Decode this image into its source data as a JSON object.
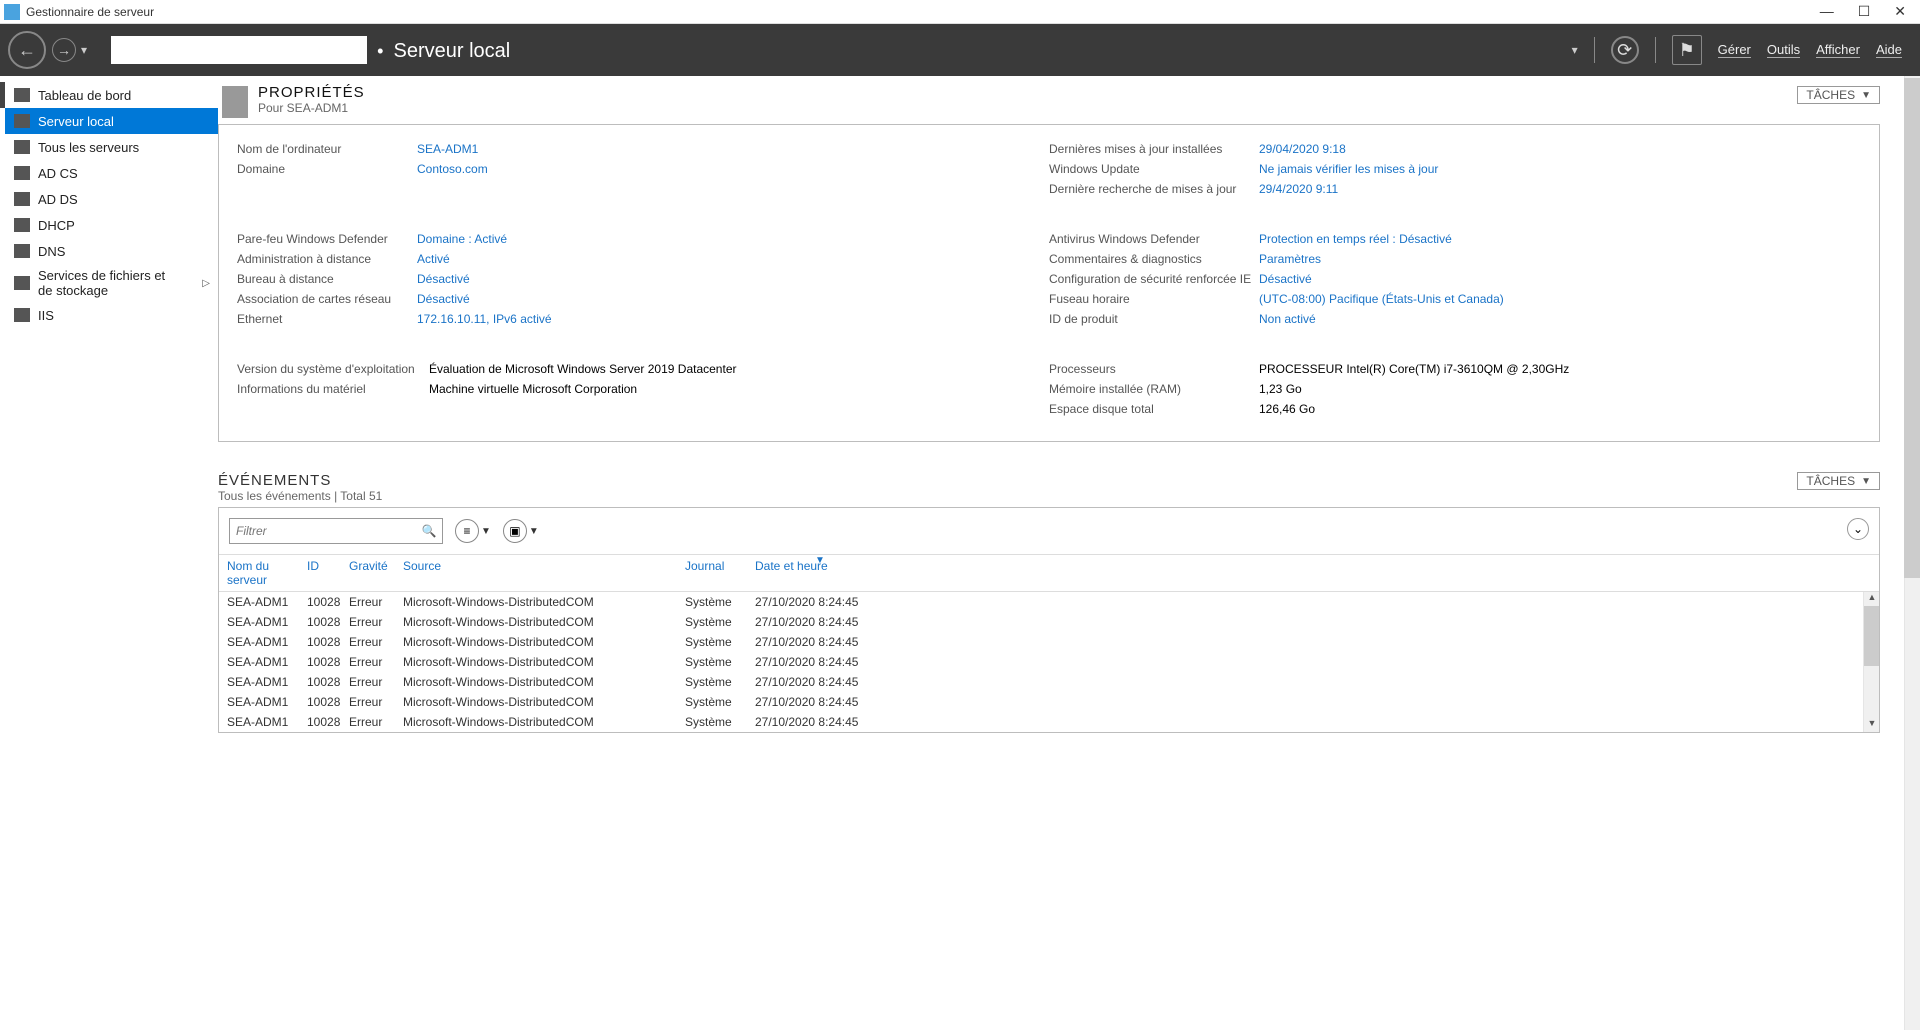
{
  "window": {
    "title": "Gestionnaire de serveur"
  },
  "breadcrumb": {
    "main": "Gestionnaire de serveur",
    "sub": "Serveur local"
  },
  "menu": {
    "gerer": "Gérer",
    "outils": "Outils",
    "afficher": "Afficher",
    "aide": "Aide"
  },
  "sidebar": {
    "items": [
      {
        "label": "Tableau de bord"
      },
      {
        "label": "Serveur local"
      },
      {
        "label": "Tous les serveurs"
      },
      {
        "label": "AD CS"
      },
      {
        "label": "AD DS"
      },
      {
        "label": "DHCP"
      },
      {
        "label": "DNS"
      },
      {
        "label": "Services de fichiers et de stockage"
      },
      {
        "label": "IIS"
      }
    ]
  },
  "properties": {
    "title": "PROPRIÉTÉS",
    "subtitle": "Pour SEA-ADM1",
    "tasks": "TÂCHES",
    "left1": [
      {
        "k": "Nom de l'ordinateur",
        "v": "SEA-ADM1",
        "link": true
      },
      {
        "k": "Domaine",
        "v": "Contoso.com",
        "link": true
      }
    ],
    "right1": [
      {
        "k": "Dernières mises à jour installées",
        "v": "29/04/2020 9:18",
        "link": true
      },
      {
        "k": "Windows Update",
        "v": "Ne jamais vérifier les mises à jour",
        "link": true
      },
      {
        "k": "Dernière recherche de mises à jour",
        "v": "29/4/2020 9:11",
        "link": true
      }
    ],
    "left2": [
      {
        "k": "Pare-feu Windows Defender",
        "v": "Domaine : Activé",
        "link": true
      },
      {
        "k": "Administration à distance",
        "v": "Activé",
        "link": true
      },
      {
        "k": "Bureau à distance",
        "v": "Désactivé",
        "link": true
      },
      {
        "k": "Association de cartes réseau",
        "v": "Désactivé",
        "link": true
      },
      {
        "k": "Ethernet",
        "v": "172.16.10.11, IPv6 activé",
        "link": true
      }
    ],
    "right2": [
      {
        "k": "Antivirus Windows Defender",
        "v": "Protection en temps réel : Désactivé",
        "link": true
      },
      {
        "k": "Commentaires & diagnostics",
        "v": "Paramètres",
        "link": true
      },
      {
        "k": "Configuration de sécurité renforcée IE",
        "v": "Désactivé",
        "link": true
      },
      {
        "k": "Fuseau horaire",
        "v": "(UTC-08:00) Pacifique (États-Unis et Canada)",
        "link": true
      },
      {
        "k": "ID de produit",
        "v": "Non activé",
        "link": true
      }
    ],
    "left3": [
      {
        "k": "Version du système d'exploitation",
        "v": "Évaluation de Microsoft Windows Server 2019 Datacenter",
        "link": false
      },
      {
        "k": "Informations du matériel",
        "v": "Machine virtuelle Microsoft Corporation",
        "link": false
      }
    ],
    "right3": [
      {
        "k": "Processeurs",
        "v": "PROCESSEUR Intel(R) Core(TM) i7-3610QM @ 2,30GHz",
        "link": false
      },
      {
        "k": "Mémoire installée (RAM)",
        "v": "1,23 Go",
        "link": false
      },
      {
        "k": "Espace disque total",
        "v": "126,46 Go",
        "link": false
      }
    ]
  },
  "events": {
    "title": "ÉVÉNEMENTS",
    "subtitle": "Tous les événements | Total 51",
    "tasks": "TÂCHES",
    "filter_placeholder": "Filtrer",
    "columns": {
      "c1": "Nom du serveur",
      "c2": "ID",
      "c3": "Gravité",
      "c4": "Source",
      "c5": "Journal",
      "c6": "Date et heure"
    },
    "rows": [
      {
        "c1": "SEA-ADM1",
        "c2": "10028",
        "c3": "Erreur",
        "c4": "Microsoft-Windows-DistributedCOM",
        "c5": "Système",
        "c6": "27/10/2020 8:24:45"
      },
      {
        "c1": "SEA-ADM1",
        "c2": "10028",
        "c3": "Erreur",
        "c4": "Microsoft-Windows-DistributedCOM",
        "c5": "Système",
        "c6": "27/10/2020 8:24:45"
      },
      {
        "c1": "SEA-ADM1",
        "c2": "10028",
        "c3": "Erreur",
        "c4": "Microsoft-Windows-DistributedCOM",
        "c5": "Système",
        "c6": "27/10/2020 8:24:45"
      },
      {
        "c1": "SEA-ADM1",
        "c2": "10028",
        "c3": "Erreur",
        "c4": "Microsoft-Windows-DistributedCOM",
        "c5": "Système",
        "c6": "27/10/2020 8:24:45"
      },
      {
        "c1": "SEA-ADM1",
        "c2": "10028",
        "c3": "Erreur",
        "c4": "Microsoft-Windows-DistributedCOM",
        "c5": "Système",
        "c6": "27/10/2020 8:24:45"
      },
      {
        "c1": "SEA-ADM1",
        "c2": "10028",
        "c3": "Erreur",
        "c4": "Microsoft-Windows-DistributedCOM",
        "c5": "Système",
        "c6": "27/10/2020 8:24:45"
      },
      {
        "c1": "SEA-ADM1",
        "c2": "10028",
        "c3": "Erreur",
        "c4": "Microsoft-Windows-DistributedCOM",
        "c5": "Système",
        "c6": "27/10/2020 8:24:45"
      }
    ]
  }
}
